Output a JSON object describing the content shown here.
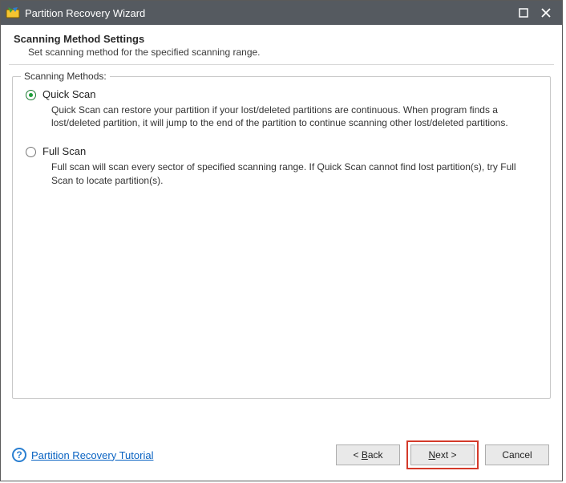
{
  "window": {
    "title": "Partition Recovery Wizard"
  },
  "header": {
    "heading": "Scanning Method Settings",
    "subheading": "Set scanning method for the specified scanning range."
  },
  "group": {
    "legend": "Scanning Methods:",
    "options": [
      {
        "label": "Quick Scan",
        "selected": true,
        "description": "Quick Scan can restore your partition if your lost/deleted partitions are continuous. When program finds a lost/deleted partition, it will jump to the end of the partition to continue scanning other lost/deleted partitions."
      },
      {
        "label": "Full Scan",
        "selected": false,
        "description": "Full scan will scan every sector of specified scanning range. If Quick Scan cannot find lost partition(s), try Full Scan to locate partition(s)."
      }
    ]
  },
  "footer": {
    "help_link": "Partition Recovery Tutorial",
    "back_prefix": "< ",
    "back_letter": "B",
    "back_rest": "ack",
    "next_letter": "N",
    "next_rest": "ext >",
    "cancel": "Cancel"
  }
}
